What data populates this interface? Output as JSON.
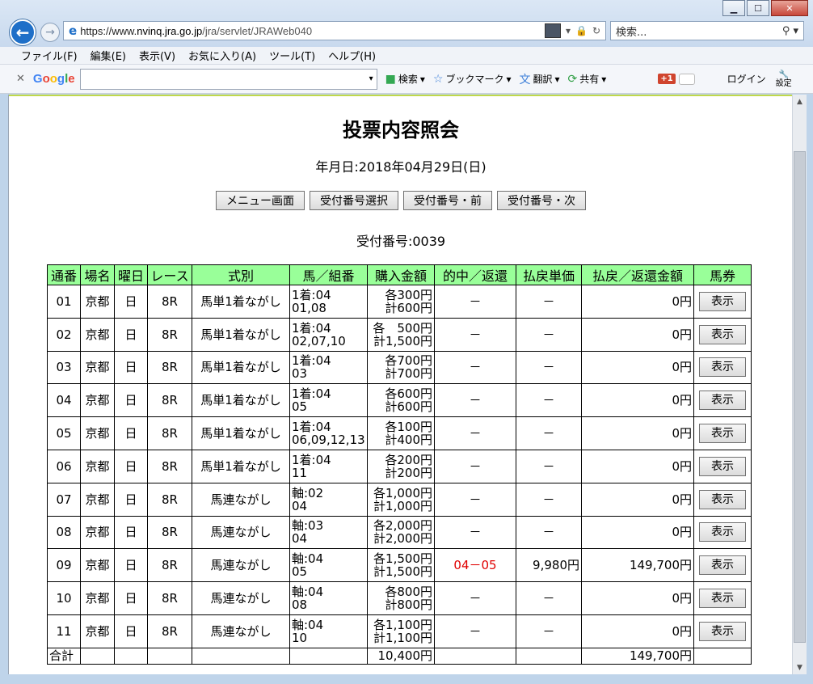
{
  "browser": {
    "url_prefix": "https://www.",
    "url_host": "nvinq.jra.go.jp",
    "url_path": "/jra/servlet/JRAWeb040",
    "search_placeholder": "検索...",
    "menu": [
      "ファイル(F)",
      "編集(E)",
      "表示(V)",
      "お気に入り(A)",
      "ツール(T)",
      "ヘルプ(H)"
    ],
    "google_toolbar": {
      "search_label": "検索",
      "bookmark_label": "ブックマーク",
      "translate_label": "翻訳",
      "share_label": "共有",
      "gplus_label": "+1",
      "login_label": "ログイン",
      "settings_label": "設定"
    }
  },
  "page": {
    "title": "投票内容照会",
    "date_line": "年月日:2018年04月29日(日)",
    "buttons": [
      "メニュー画面",
      "受付番号選択",
      "受付番号・前",
      "受付番号・次"
    ],
    "receipt": "受付番号:0039"
  },
  "table": {
    "headers": [
      "通番",
      "場名",
      "曜日",
      "レース",
      "式別",
      "馬／組番",
      "購入金額",
      "的中／返還",
      "払戻単価",
      "払戻／返還金額",
      "馬券"
    ],
    "rows": [
      {
        "no": "01",
        "venue": "京都",
        "day": "日",
        "race": "8R",
        "type": "馬単1着ながし",
        "horse1": "1着:04",
        "horse2": "01,08",
        "amt1": "各300円",
        "amt2": "計600円",
        "hit": "－",
        "unit": "－",
        "payout": "0円",
        "ticket": "表示"
      },
      {
        "no": "02",
        "venue": "京都",
        "day": "日",
        "race": "8R",
        "type": "馬単1着ながし",
        "horse1": "1着:04",
        "horse2": "02,07,10",
        "amt1": "各　500円",
        "amt2": "計1,500円",
        "hit": "－",
        "unit": "－",
        "payout": "0円",
        "ticket": "表示"
      },
      {
        "no": "03",
        "venue": "京都",
        "day": "日",
        "race": "8R",
        "type": "馬単1着ながし",
        "horse1": "1着:04",
        "horse2": "03",
        "amt1": "各700円",
        "amt2": "計700円",
        "hit": "－",
        "unit": "－",
        "payout": "0円",
        "ticket": "表示"
      },
      {
        "no": "04",
        "venue": "京都",
        "day": "日",
        "race": "8R",
        "type": "馬単1着ながし",
        "horse1": "1着:04",
        "horse2": "05",
        "amt1": "各600円",
        "amt2": "計600円",
        "hit": "－",
        "unit": "－",
        "payout": "0円",
        "ticket": "表示"
      },
      {
        "no": "05",
        "venue": "京都",
        "day": "日",
        "race": "8R",
        "type": "馬単1着ながし",
        "horse1": "1着:04",
        "horse2": "06,09,12,13",
        "amt1": "各100円",
        "amt2": "計400円",
        "hit": "－",
        "unit": "－",
        "payout": "0円",
        "ticket": "表示"
      },
      {
        "no": "06",
        "venue": "京都",
        "day": "日",
        "race": "8R",
        "type": "馬単1着ながし",
        "horse1": "1着:04",
        "horse2": "11",
        "amt1": "各200円",
        "amt2": "計200円",
        "hit": "－",
        "unit": "－",
        "payout": "0円",
        "ticket": "表示"
      },
      {
        "no": "07",
        "venue": "京都",
        "day": "日",
        "race": "8R",
        "type": "馬連ながし",
        "horse1": "軸:02",
        "horse2": "04",
        "amt1": "各1,000円",
        "amt2": "計1,000円",
        "hit": "－",
        "unit": "－",
        "payout": "0円",
        "ticket": "表示"
      },
      {
        "no": "08",
        "venue": "京都",
        "day": "日",
        "race": "8R",
        "type": "馬連ながし",
        "horse1": "軸:03",
        "horse2": "04",
        "amt1": "各2,000円",
        "amt2": "計2,000円",
        "hit": "－",
        "unit": "－",
        "payout": "0円",
        "ticket": "表示"
      },
      {
        "no": "09",
        "venue": "京都",
        "day": "日",
        "race": "8R",
        "type": "馬連ながし",
        "horse1": "軸:04",
        "horse2": "05",
        "amt1": "各1,500円",
        "amt2": "計1,500円",
        "hit": "04－05",
        "unit": "9,980円",
        "payout": "149,700円",
        "ticket": "表示"
      },
      {
        "no": "10",
        "venue": "京都",
        "day": "日",
        "race": "8R",
        "type": "馬連ながし",
        "horse1": "軸:04",
        "horse2": "08",
        "amt1": "各800円",
        "amt2": "計800円",
        "hit": "－",
        "unit": "－",
        "payout": "0円",
        "ticket": "表示"
      },
      {
        "no": "11",
        "venue": "京都",
        "day": "日",
        "race": "8R",
        "type": "馬連ながし",
        "horse1": "軸:04",
        "horse2": "10",
        "amt1": "各1,100円",
        "amt2": "計1,100円",
        "hit": "－",
        "unit": "－",
        "payout": "0円",
        "ticket": "表示"
      }
    ],
    "total": {
      "label": "合計",
      "amount": "10,400円",
      "payout": "149,700円"
    }
  }
}
